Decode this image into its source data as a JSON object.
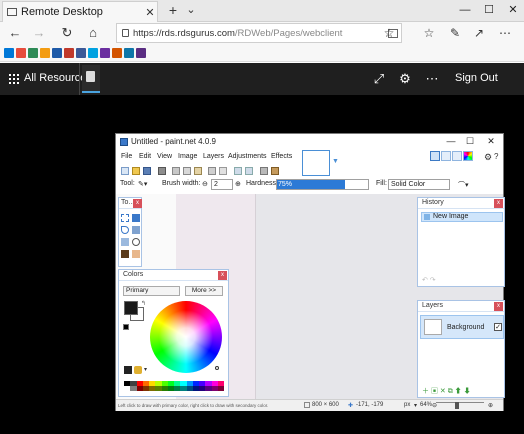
{
  "browser": {
    "tab_title": "Remote Desktop",
    "tab_close": "✕",
    "new_tab": "+",
    "tab_list": "⌄",
    "minimize": "—",
    "maximize": "☐",
    "close": "✕",
    "back": "←",
    "forward": "→",
    "refresh": "↻",
    "home": "⌂",
    "url_host": "https://rds.rdsgurus.com",
    "url_path": "/RDWeb/Pages/webclient",
    "favorite": "☆",
    "favorites_hub": "☆",
    "notes": "✎",
    "share": "↗",
    "more": "⋯",
    "favbar_colors": [
      "#0078d7",
      "#e74c3c",
      "#2e8b57",
      "#f39c12",
      "#1e5aa8",
      "#c0392b",
      "#3b5998",
      "#00a1e0",
      "#6b2fa0",
      "#d35400",
      "#0e76a8",
      "#5a2d82"
    ]
  },
  "rd": {
    "all_resources": "All Resources",
    "expand_icon": "⤢",
    "settings_icon": "⚙",
    "more_icon": "⋯",
    "sign_out": "Sign Out"
  },
  "paintnet": {
    "title": "Untitled - paint.net 4.0.9",
    "minimize": "—",
    "maximize": "☐",
    "close": "✕",
    "menus": [
      "File",
      "Edit",
      "View",
      "Image",
      "Layers",
      "Adjustments",
      "Effects"
    ],
    "toolbar": {
      "tool_label": "Tool:",
      "brush_width_label": "Brush width:",
      "brush_width_value": "2",
      "hardness_label": "Hardness:",
      "hardness_value": "75%",
      "hardness_fraction": 0.75,
      "fill_label": "Fill:",
      "fill_value": "Solid Color"
    },
    "tools_panel": {
      "title": "To...",
      "close": "x"
    },
    "colors_panel": {
      "title": "Colors",
      "close": "x",
      "mode": "Primary",
      "more_button": "More >>",
      "primary": "#1a1a1a",
      "secondary": "#ffffff",
      "palette": [
        "#000000",
        "#404040",
        "#ff0000",
        "#ff6a00",
        "#ffd800",
        "#b6ff00",
        "#4cff00",
        "#00ff21",
        "#00ff90",
        "#00ffff",
        "#0094ff",
        "#0026ff",
        "#4800ff",
        "#b200ff",
        "#ff00dc",
        "#ff006e",
        "#ffffff",
        "#808080",
        "#7f0000",
        "#7f3300",
        "#7f6a00",
        "#5b7f00",
        "#267f00",
        "#007f0e",
        "#007f46",
        "#007f7f",
        "#004a7f",
        "#00137f",
        "#21007f",
        "#57007f",
        "#7f006e",
        "#7f0037"
      ]
    },
    "history_panel": {
      "title": "History",
      "close": "x",
      "item": "New Image"
    },
    "layers_panel": {
      "title": "Layers",
      "close": "x",
      "layer_name": "Background",
      "layer_check": "✓"
    },
    "status": {
      "hint": "Left click to draw with primary color, right click to draw with secondary color.",
      "size": "800 × 600",
      "coords": "-171, -179",
      "unit": "px",
      "zoom": "64%"
    }
  }
}
